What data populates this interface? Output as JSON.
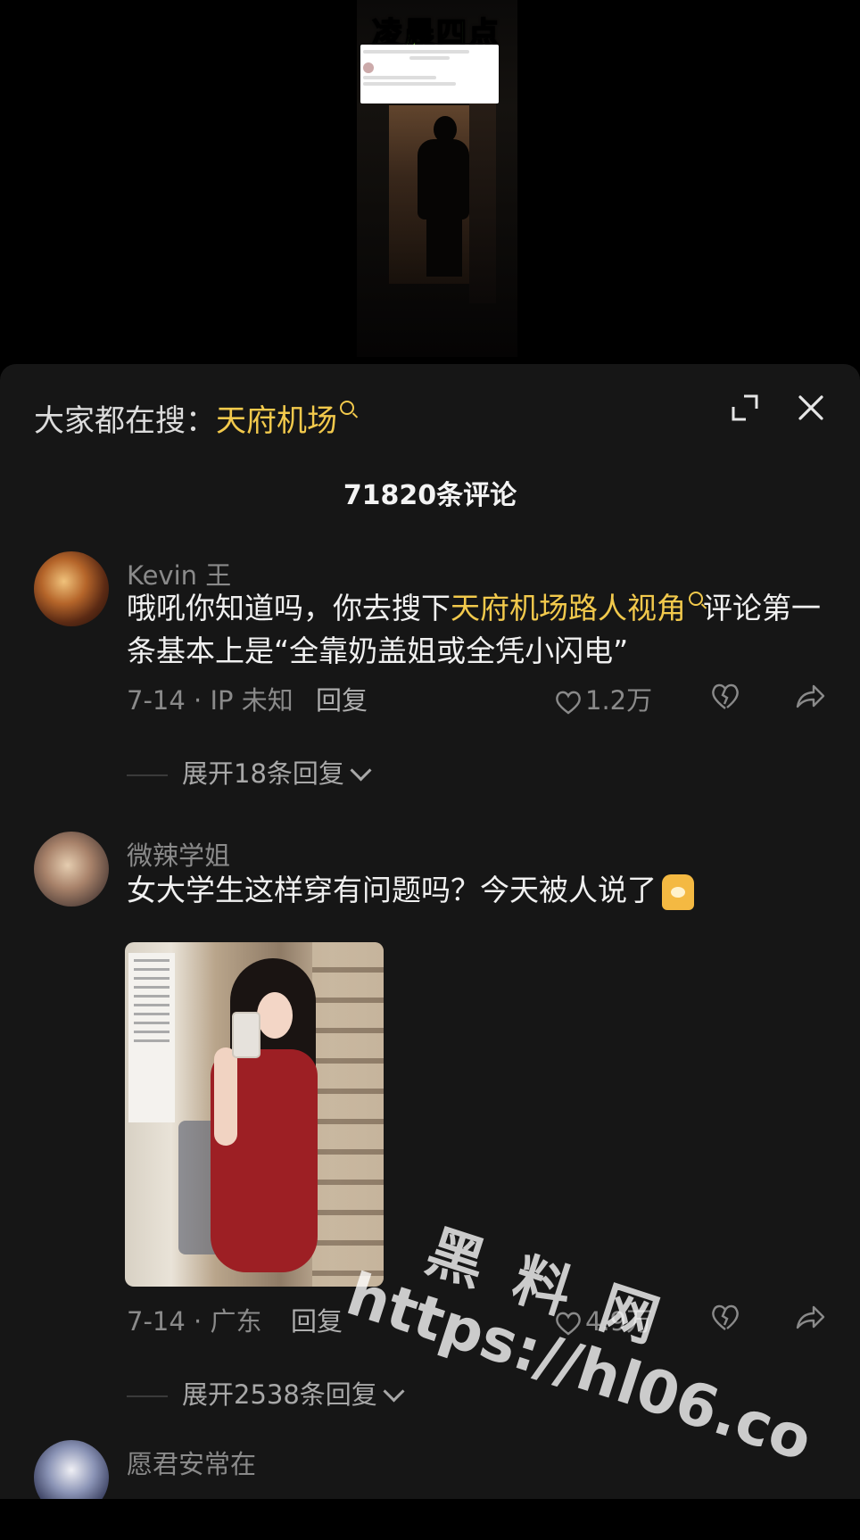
{
  "video": {
    "title": "凌晨四点"
  },
  "header": {
    "hot_search_prefix": "大家都在搜：",
    "hot_search_keyword": "天府机场",
    "comment_count": "71820条评论"
  },
  "comments": [
    {
      "username": "Kevin 王",
      "text_before": "哦吼你知道吗，你去搜下",
      "link": "天府机场路人视角",
      "text_after": "评论第一条基本上是“全靠奶盖姐或全凭小闪电”",
      "meta": "7-14 · IP 未知",
      "reply": "回复",
      "likes": "1.2万",
      "expand": "展开18条回复"
    },
    {
      "username": "微辣学姐",
      "text": "女大学生这样穿有问题吗？今天被人说了",
      "meta": "7-14 · 广东",
      "reply": "回复",
      "likes": "4.9万",
      "expand": "展开2538条回复"
    },
    {
      "username": "愿君安常在"
    }
  ],
  "watermark": {
    "title": "黑料网",
    "url": "https://hl06.co"
  },
  "icons": {
    "search": "search-icon",
    "expand": "expand-icon",
    "close": "close-icon",
    "like": "heart-icon",
    "dislike": "broken-heart-icon",
    "share": "share-icon"
  },
  "colors": {
    "accent": "#f2c94c",
    "panel": "#161616",
    "title_green": "#8ef04a"
  }
}
